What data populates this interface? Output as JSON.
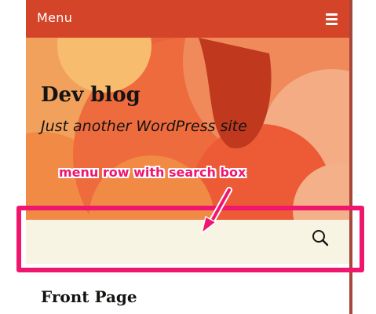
{
  "topbar": {
    "menu_label": "Menu",
    "menu_icon": "hamburger-icon"
  },
  "header": {
    "site_title": "Dev blog",
    "tagline": "Just another WordPress site"
  },
  "search": {
    "value": "",
    "placeholder": "",
    "icon": "search-icon"
  },
  "content": {
    "entry_title": "Front Page"
  },
  "annotation": {
    "text": "menu row with search box",
    "color": "#f0166e"
  },
  "colors": {
    "topbar": "#d44429",
    "search_row": "#f7f4e3",
    "text": "#141412"
  }
}
